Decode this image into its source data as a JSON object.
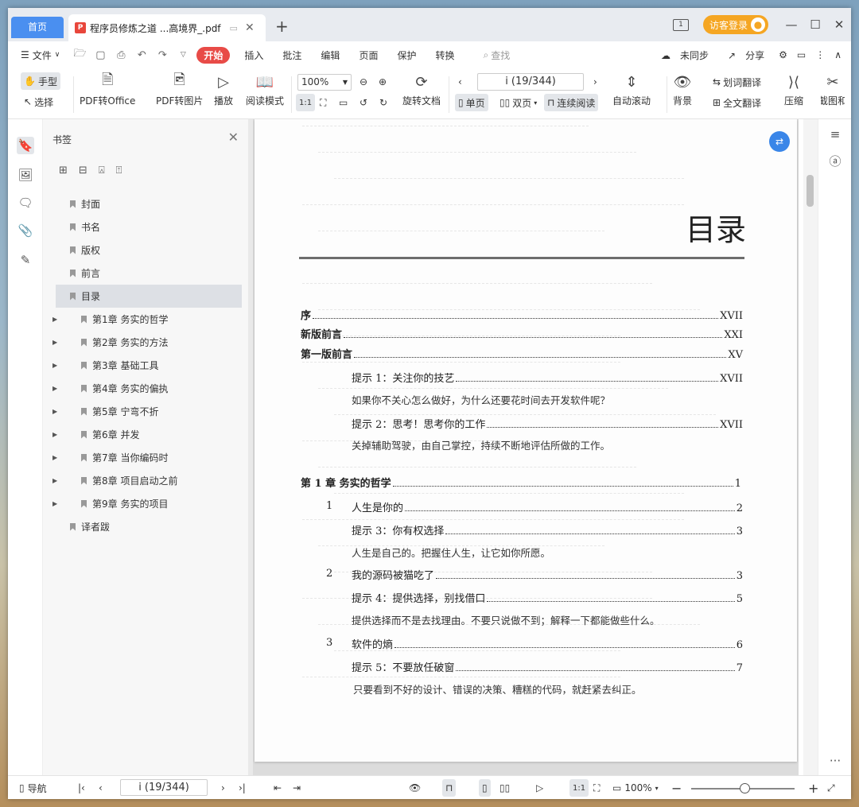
{
  "titlebar": {
    "home_tab": "首页",
    "doc_tab": "程序员修炼之道 ...高境界_.pdf",
    "pdf_badge": "P",
    "login": "访客登录",
    "sidepanel": "1"
  },
  "menu": {
    "file": "文件",
    "start": "开始",
    "items": [
      "插入",
      "批注",
      "编辑",
      "页面",
      "保护",
      "转换"
    ],
    "search": "查找",
    "unsync": "未同步",
    "share": "分享"
  },
  "ribbon": {
    "hand": "手型",
    "select": "选择",
    "pdf2office": "PDF转Office",
    "pdf2img": "PDF转图片",
    "play": "播放",
    "readmode": "阅读模式",
    "zoom": "100%",
    "rotate": "旋转文档",
    "page": "i (19/344)",
    "single": "单页",
    "double": "双页",
    "continuous": "连续阅读",
    "autoscroll": "自动滚动",
    "bg": "背景",
    "wordtrans": "划词翻译",
    "fulltrans": "全文翻译",
    "compress": "压缩",
    "screenshot": "截图和"
  },
  "bookmarks": {
    "title": "书签",
    "items": [
      {
        "label": "封面",
        "expand": false,
        "selected": false
      },
      {
        "label": "书名",
        "expand": false,
        "selected": false
      },
      {
        "label": "版权",
        "expand": false,
        "selected": false
      },
      {
        "label": "前言",
        "expand": false,
        "selected": false
      },
      {
        "label": "目录",
        "expand": false,
        "selected": true
      },
      {
        "label": "第1章  务实的哲学",
        "expand": true,
        "selected": false
      },
      {
        "label": "第2章  务实的方法",
        "expand": true,
        "selected": false
      },
      {
        "label": "第3章  基础工具",
        "expand": true,
        "selected": false
      },
      {
        "label": "第4章  务实的偏执",
        "expand": true,
        "selected": false
      },
      {
        "label": "第5章  宁弯不折",
        "expand": true,
        "selected": false
      },
      {
        "label": "第6章  并发",
        "expand": true,
        "selected": false
      },
      {
        "label": "第7章  当你编码时",
        "expand": true,
        "selected": false
      },
      {
        "label": "第8章  项目启动之前",
        "expand": true,
        "selected": false
      },
      {
        "label": "第9章  务实的项目",
        "expand": true,
        "selected": false
      },
      {
        "label": "译者跋",
        "expand": false,
        "selected": false
      }
    ]
  },
  "toc": {
    "heading": "目录",
    "entries": [
      {
        "title": "序",
        "page": "XVII"
      },
      {
        "title": "新版前言",
        "page": "XXI"
      },
      {
        "title": "第一版前言",
        "page": "XV"
      },
      {
        "title": "提示 1：关注你的技艺",
        "page": "XVII"
      },
      {
        "title": "提示 2：思考！思考你的工作",
        "page": "XVII"
      },
      {
        "title": "第 1 章   务实的哲学",
        "page": "1"
      },
      {
        "title": "人生是你的",
        "page": "2"
      },
      {
        "title": "提示 3：你有权选择",
        "page": "3"
      },
      {
        "title": "我的源码被猫吃了",
        "page": "3"
      },
      {
        "title": "提示 4：提供选择，别找借口",
        "page": "5"
      },
      {
        "title": "软件的熵",
        "page": "6"
      },
      {
        "title": "提示 5：不要放任破窗",
        "page": "7"
      }
    ],
    "numbers": [
      "1",
      "2",
      "3"
    ],
    "descs": [
      "如果你不关心怎么做好，为什么还要花时间去开发软件呢？",
      "关掉辅助驾驶，由自己掌控，持续不断地评估所做的工作。",
      "人生是自己的。把握住人生，让它如你所愿。",
      "提供选择而不是去找理由。不要只说做不到；解释一下都能做些什么。",
      "只要看到不好的设计、错误的决策、糟糕的代码，就赶紧去纠正。"
    ]
  },
  "status": {
    "nav": "导航",
    "page": "i (19/344)",
    "zoom": "100%"
  }
}
